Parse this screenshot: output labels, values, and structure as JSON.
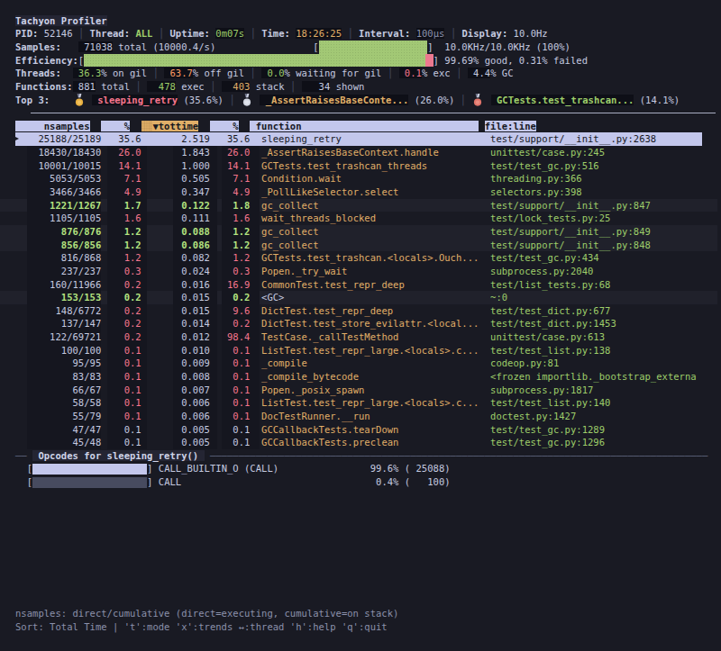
{
  "app": {
    "title": "Tachyon Profiler"
  },
  "status": {
    "pid_label": "PID:",
    "pid": "52146",
    "thread_label": "Thread:",
    "thread": "ALL",
    "uptime_label": "Uptime:",
    "uptime": "0m07s",
    "time_label": "Time:",
    "time": "18:26:25",
    "interval_label": "Interval:",
    "interval": "100µs",
    "display_label": "Display:",
    "display": "10.0Hz",
    "separator": "│"
  },
  "samples": {
    "label": "Samples:",
    "total": "71038",
    "suffix": " total (10000.4/s)",
    "bar_cells": 19,
    "bar_fill_pct": 100,
    "right_text": "10.0KHz/10.0KHz (100%)"
  },
  "efficiency": {
    "label": "Efficiency:",
    "bar_cells": 61,
    "good_pct": 99.69,
    "failed_pct": 0.31,
    "right_text": "99.69% good, 0.31% failed"
  },
  "threads": {
    "label": "Threads:",
    "items": [
      {
        "value": "36.3",
        "suffix": "% on gil",
        "color": "grn",
        "pad": 1
      },
      {
        "value": "63.7",
        "suffix": "% off gil",
        "color": "org",
        "pad": 1
      },
      {
        "value": "0.0",
        "suffix": "% waiting for gil",
        "color": "grn",
        "pad": 1
      },
      {
        "value": "0.1",
        "suffix": "% exc",
        "color": "red",
        "pad": 1
      },
      {
        "value": "4.4",
        "suffix": "% GC",
        "color": "fg",
        "pad": 1
      }
    ]
  },
  "functions_line": {
    "label": "Functions:",
    "items": [
      {
        "value": "881",
        "suffix": " total",
        "color": "fg",
        "pad": 1
      },
      {
        "value": "478",
        "suffix": " exec",
        "color": "grn",
        "pad": 2
      },
      {
        "value": "403",
        "suffix": " stack",
        "color": "yel",
        "pad": 2
      },
      {
        "value": "34",
        "suffix": " shown",
        "color": "fg",
        "pad": 3
      }
    ]
  },
  "top3": {
    "label": "Top 3:",
    "items": [
      {
        "rank": 1,
        "medal": "gold-medal-icon",
        "name": "sleeping_retry",
        "pct": "(35.6%)",
        "color": "red"
      },
      {
        "rank": 2,
        "medal": "silver-medal-icon",
        "name": "_AssertRaisesBaseConte...",
        "pct": "(26.0%)",
        "color": "yel"
      },
      {
        "rank": 3,
        "medal": "bronze-medal-icon",
        "name": "GCTests.test_trashcan...",
        "pct": "(14.1%)",
        "color": "grn"
      }
    ]
  },
  "table": {
    "headers": [
      {
        "key": "nsamples",
        "label": "nsamples"
      },
      {
        "key": "pct_direct",
        "label": "%"
      },
      {
        "key": "tottime",
        "label": "▼tottime",
        "sorted": true
      },
      {
        "key": "pct_cumulative",
        "label": "%"
      },
      {
        "key": "function",
        "label": "function"
      },
      {
        "key": "file_line",
        "label": "file:line"
      }
    ],
    "rows": [
      {
        "ns": "25188/25189",
        "p1": "35.6",
        "tot": "2.519",
        "p2": "35.6",
        "fn": "sleeping_retry",
        "file": "test/support/__init__.py:2638",
        "style": "sel"
      },
      {
        "ns": "18430/18430",
        "p1": "26.0",
        "tot": "1.843",
        "p2": "26.0",
        "fn": "_AssertRaisesBaseContext.handle",
        "file": "unittest/case.py:245",
        "style": "normal"
      },
      {
        "ns": "10001/10015",
        "p1": "14.1",
        "tot": "1.000",
        "p2": "14.1",
        "fn": "GCTests.test_trashcan_threads",
        "file": "test/test_gc.py:516",
        "style": "normal"
      },
      {
        "ns": "5053/5053",
        "p1": "7.1",
        "tot": "0.505",
        "p2": "7.1",
        "fn": "Condition.wait",
        "file": "threading.py:366",
        "style": "normal"
      },
      {
        "ns": "3466/3466",
        "p1": "4.9",
        "tot": "0.347",
        "p2": "4.9",
        "fn": "_PollLikeSelector.select",
        "file": "selectors.py:398",
        "style": "normal"
      },
      {
        "ns": "1221/1267",
        "p1": "1.7",
        "tot": "0.122",
        "p2": "1.8",
        "fn": "gc_collect",
        "file": "test/support/__init__.py:847",
        "style": "trend"
      },
      {
        "ns": "1105/1105",
        "p1": "1.6",
        "tot": "0.111",
        "p2": "1.6",
        "fn": "wait_threads_blocked",
        "file": "test/lock_tests.py:25",
        "style": "normal"
      },
      {
        "ns": "876/876",
        "p1": "1.2",
        "tot": "0.088",
        "p2": "1.2",
        "fn": "gc_collect",
        "file": "test/support/__init__.py:849",
        "style": "trend"
      },
      {
        "ns": "856/856",
        "p1": "1.2",
        "tot": "0.086",
        "p2": "1.2",
        "fn": "gc_collect",
        "file": "test/support/__init__.py:848",
        "style": "trend"
      },
      {
        "ns": "816/868",
        "p1": "1.2",
        "tot": "0.082",
        "p2": "1.2",
        "fn": "GCTests.test_trashcan.<locals>.Ouch...",
        "file": "test/test_gc.py:434",
        "style": "normal"
      },
      {
        "ns": "237/237",
        "p1": "0.3",
        "tot": "0.024",
        "p2": "0.3",
        "fn": "Popen._try_wait",
        "file": "subprocess.py:2040",
        "style": "normal"
      },
      {
        "ns": "160/11966",
        "p1": "0.2",
        "tot": "0.016",
        "p2": "16.9",
        "fn": "CommonTest.test_repr_deep",
        "file": "test/list_tests.py:68",
        "style": "normal"
      },
      {
        "ns": "153/153",
        "p1": "0.2",
        "tot": "0.015",
        "p2": "0.2",
        "fn": "<GC>",
        "file": "~:0",
        "style": "trendgc"
      },
      {
        "ns": "148/6772",
        "p1": "0.2",
        "tot": "0.015",
        "p2": "9.6",
        "fn": "DictTest.test_repr_deep",
        "file": "test/test_dict.py:677",
        "style": "normal"
      },
      {
        "ns": "137/147",
        "p1": "0.2",
        "tot": "0.014",
        "p2": "0.2",
        "fn": "DictTest.test_store_evilattr.<local...",
        "file": "test/test_dict.py:1453",
        "style": "normal"
      },
      {
        "ns": "122/69721",
        "p1": "0.2",
        "tot": "0.012",
        "p2": "98.4",
        "fn": "TestCase._callTestMethod",
        "file": "unittest/case.py:613",
        "style": "normal"
      },
      {
        "ns": "100/100",
        "p1": "0.1",
        "tot": "0.010",
        "p2": "0.1",
        "fn": "ListTest.test_repr_large.<locals>.c...",
        "file": "test/test_list.py:138",
        "style": "normal"
      },
      {
        "ns": "95/95",
        "p1": "0.1",
        "tot": "0.009",
        "p2": "0.1",
        "fn": "_compile",
        "file": "codeop.py:81",
        "style": "normal"
      },
      {
        "ns": "83/83",
        "p1": "0.1",
        "tot": "0.008",
        "p2": "0.1",
        "fn": "_compile_bytecode",
        "file": "<frozen importlib._bootstrap_externa",
        "style": "normal"
      },
      {
        "ns": "66/67",
        "p1": "0.1",
        "tot": "0.007",
        "p2": "0.1",
        "fn": "Popen._posix_spawn",
        "file": "subprocess.py:1817",
        "style": "normal"
      },
      {
        "ns": "58/58",
        "p1": "0.1",
        "tot": "0.006",
        "p2": "0.1",
        "fn": "ListTest.test_repr_large.<locals>.c...",
        "file": "test/test_list.py:140",
        "style": "normal"
      },
      {
        "ns": "55/79",
        "p1": "0.1",
        "tot": "0.006",
        "p2": "0.1",
        "fn": "DocTestRunner.__run",
        "file": "doctest.py:1427",
        "style": "normal"
      },
      {
        "ns": "47/47",
        "p1": "0.1",
        "tot": "0.005",
        "p2": "0.1",
        "fn": "GCCallbackTests.tearDown",
        "file": "test/test_gc.py:1289",
        "style": "dim"
      },
      {
        "ns": "45/48",
        "p1": "0.1",
        "tot": "0.005",
        "p2": "0.1",
        "fn": "GCCallbackTests.preclean",
        "file": "test/test_gc.py:1296",
        "style": "dim"
      }
    ]
  },
  "opcodes": {
    "title": "Opcodes for sleeping_retry()",
    "rows": [
      {
        "opcode": "CALL_BUILTIN_O (CALL)",
        "bar_fill_pct": 99.6,
        "pct_text": "99.6% ( 25088)"
      },
      {
        "opcode": "CALL",
        "bar_fill_pct": 0.4,
        "pct_text": " 0.4% (   100)"
      }
    ]
  },
  "footer": {
    "line1": "nsamples: direct/cumulative (direct=executing, cumulative=on stack)",
    "line2": "Sort: Total Time | 't':mode 'x':trends ↔:thread 'h':help 'q':quit"
  },
  "colors": {
    "background": "#13141c",
    "foreground": "#c6cbe0",
    "green": "#9ece6a",
    "red": "#f7768e",
    "orange": "#ff9e64",
    "yellow": "#e0af68",
    "selection": "#c8ccea",
    "bar_green": "#a7cd78",
    "bar_pink": "#ec798f",
    "bar_empty": "#474b5f"
  }
}
